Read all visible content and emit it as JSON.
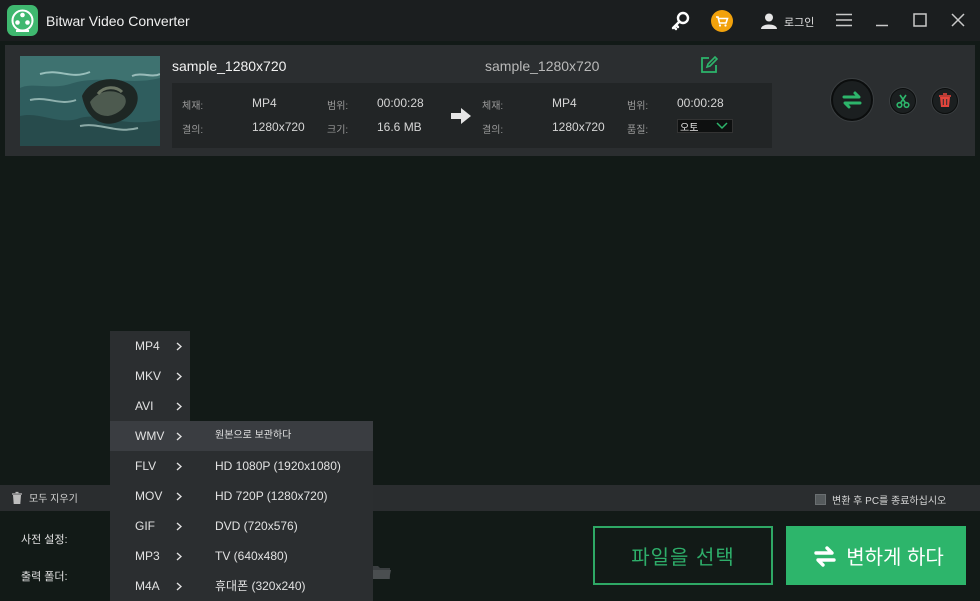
{
  "window": {
    "title": "Bitwar Video Converter",
    "login_label": "로그인",
    "icons": [
      "app-logo-icon",
      "key-icon",
      "cart-icon",
      "user-icon",
      "menu-icon",
      "minimize-icon",
      "maximize-icon",
      "close-icon"
    ]
  },
  "file": {
    "source_name": "sample_1280x720",
    "output_name": "sample_1280x720",
    "source": {
      "format_label": "체재:",
      "format": "MP4",
      "duration_label": "범위:",
      "duration": "00:00:28",
      "resolution_label": "결의:",
      "resolution": "1280x720",
      "size_label": "크기:",
      "size": "16.6 MB"
    },
    "output": {
      "format_label": "체재:",
      "format": "MP4",
      "duration_label": "범위:",
      "duration": "00:00:28",
      "resolution_label": "결의:",
      "resolution": "1280x720",
      "quality_label": "품질:",
      "quality": "오토"
    }
  },
  "format_menu": {
    "items": [
      "MP4",
      "MKV",
      "AVI",
      "WMV",
      "FLV",
      "MOV",
      "GIF",
      "MP3",
      "M4A"
    ],
    "active": "WMV"
  },
  "preset_menu": {
    "items": [
      "원본으로 보관하다",
      "HD 1080P (1920x1080)",
      "HD 720P (1280x720)",
      "DVD (720x576)",
      "TV (640x480)",
      "휴대폰 (320x240)"
    ]
  },
  "toolbar": {
    "clear_all": "모두 지우기",
    "shutdown_after": "변환 후 PC를 종료하십시오"
  },
  "bottom": {
    "preset_label": "사전 설정:",
    "output_folder_label": "출력 폴더:",
    "choose_file": "파일을 선택",
    "convert": "변하게 하다"
  },
  "colors": {
    "accent": "#2db56b",
    "cart": "#f2a20c",
    "delete": "#e2453c"
  }
}
